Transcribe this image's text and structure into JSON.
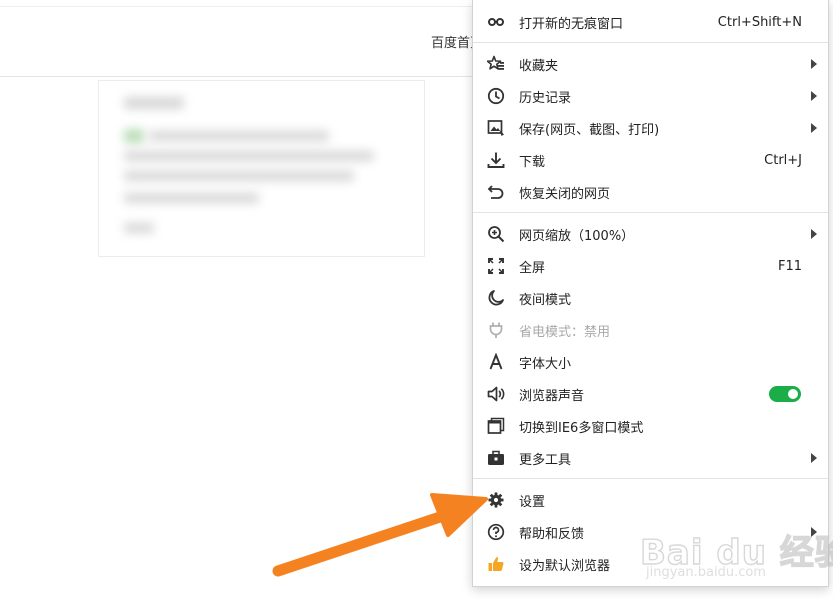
{
  "page": {
    "link_text": "百度首页"
  },
  "menu": {
    "items": [
      {
        "label": "打开新的无痕窗口",
        "shortcut": "Ctrl+Shift+N",
        "icon": "incognito-icon"
      },
      {
        "label": "收藏夹",
        "icon": "favorites-star-icon"
      },
      {
        "label": "历史记录",
        "icon": "history-clock-icon"
      },
      {
        "label": "保存(网页、截图、打印)",
        "icon": "save-image-icon"
      },
      {
        "label": "下载",
        "shortcut": "Ctrl+J",
        "icon": "download-icon"
      },
      {
        "label": "恢复关闭的网页",
        "icon": "undo-icon"
      },
      {
        "label": "网页缩放（100%）",
        "icon": "zoom-in-icon"
      },
      {
        "label": "全屏",
        "shortcut": "F11",
        "icon": "fullscreen-icon"
      },
      {
        "label": "夜间模式",
        "icon": "moon-icon"
      },
      {
        "label": "省电模式：禁用",
        "icon": "plug-icon",
        "disabled": true
      },
      {
        "label": "字体大小",
        "icon": "font-size-icon"
      },
      {
        "label": "浏览器声音",
        "icon": "speaker-icon",
        "toggle": "on"
      },
      {
        "label": "切换到IE6多窗口模式",
        "icon": "windows-icon"
      },
      {
        "label": "更多工具",
        "icon": "toolbox-icon"
      },
      {
        "label": "设置",
        "icon": "gear-icon"
      },
      {
        "label": "帮助和反馈",
        "icon": "help-icon"
      },
      {
        "label": "设为默认浏览器",
        "icon": "thumbs-up-icon"
      }
    ]
  },
  "colors": {
    "toggle_on": "#1aad48",
    "annotation_arrow": "#f58220",
    "thumbs_up": "#f5a623"
  },
  "watermark": {
    "brand": "Bai du 经验",
    "url": "jingyan.baidu.com"
  }
}
